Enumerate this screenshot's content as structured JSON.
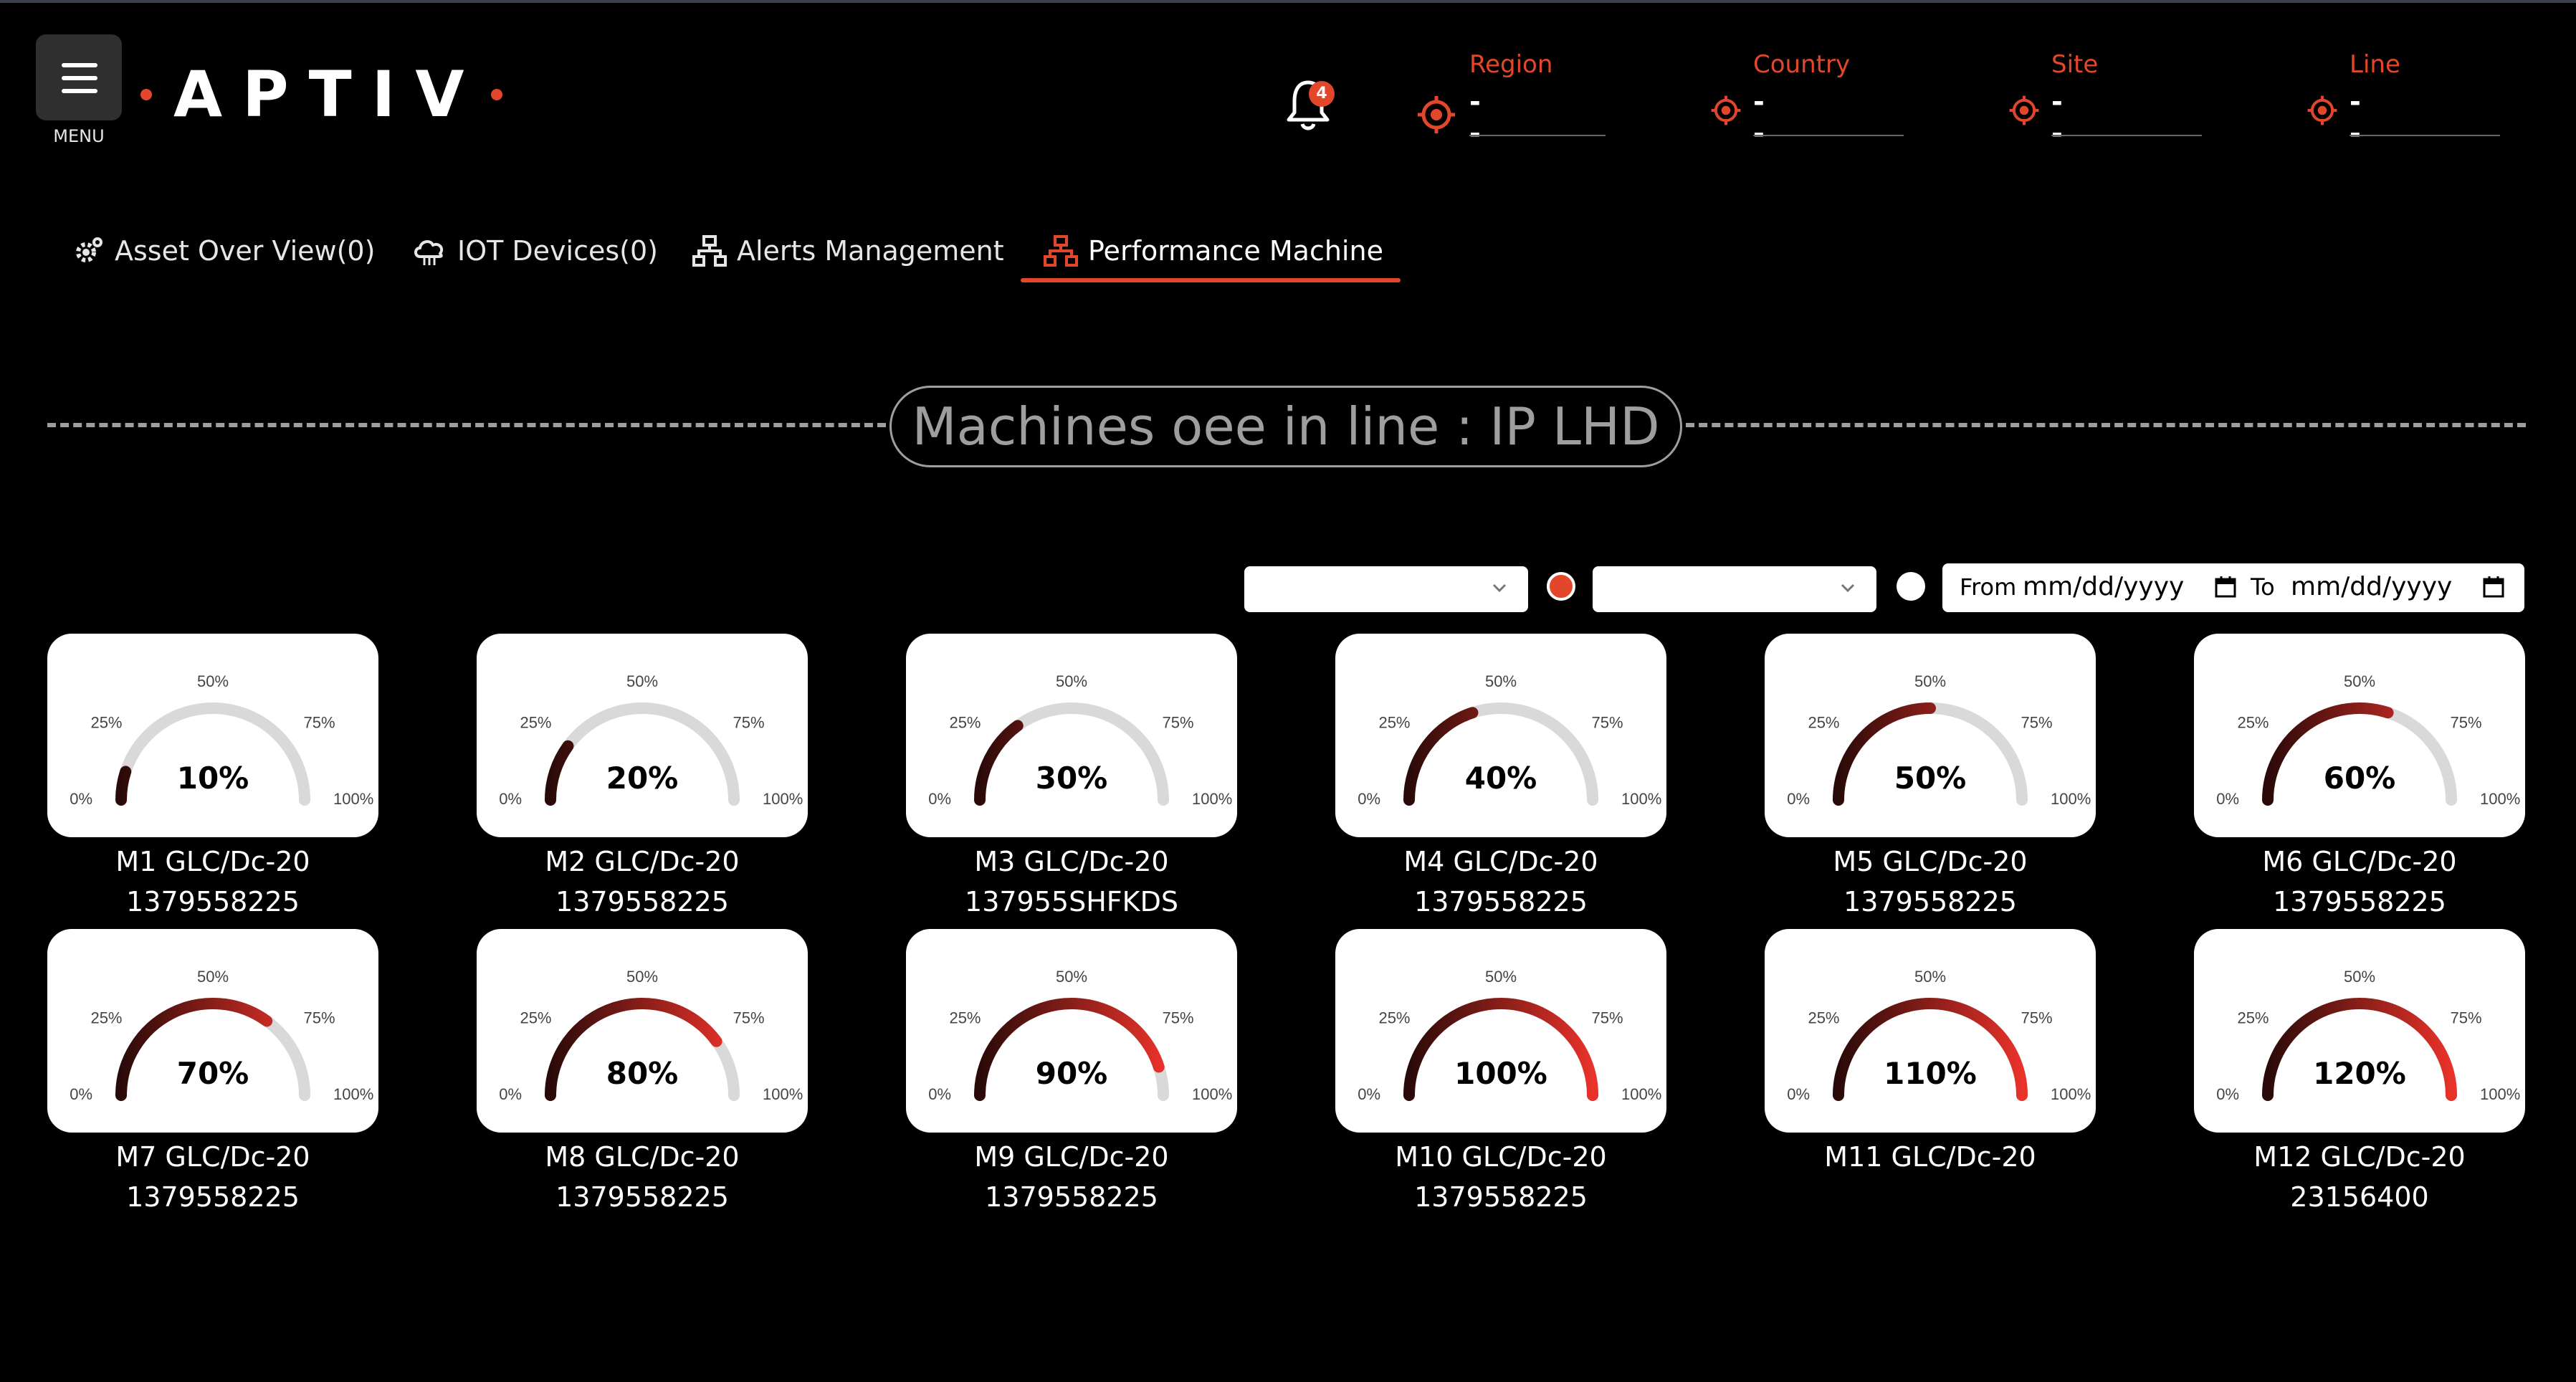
{
  "header": {
    "menu_label": "MENU",
    "brand": "APTIV",
    "notifications_count": "4",
    "filters": [
      {
        "label": "Region",
        "value": "--"
      },
      {
        "label": "Country",
        "value": "--"
      },
      {
        "label": "Site",
        "value": "--"
      },
      {
        "label": "Line",
        "value": "--"
      }
    ]
  },
  "tabs": [
    {
      "label": "Asset Over View(0)",
      "icon": "gear-icon",
      "active": false
    },
    {
      "label": "IOT Devices(0)",
      "icon": "cloud-icon",
      "active": false
    },
    {
      "label": "Alerts Management",
      "icon": "network-icon",
      "active": false
    },
    {
      "label": "Performance Machine",
      "icon": "network-icon",
      "active": true
    }
  ],
  "section_title": "Machines oee in line : IP LHD",
  "date_range": {
    "from_label": "From",
    "from_placeholder": "mm/dd/yyyy",
    "to_label": "To",
    "to_placeholder": "mm/dd/yyyy"
  },
  "gauge_ticks": [
    "0%",
    "25%",
    "50%",
    "75%",
    "100%"
  ],
  "colors": {
    "accent": "#e2472b",
    "gauge_track": "#d9d9d9",
    "gauge_dark": "#2a0a08",
    "gauge_red": "#e8322a"
  },
  "machines": [
    {
      "value": 10,
      "display": "10%",
      "name": "M1 GLC/Dc-20",
      "code": "1379558225"
    },
    {
      "value": 20,
      "display": "20%",
      "name": "M2 GLC/Dc-20",
      "code": "1379558225"
    },
    {
      "value": 30,
      "display": "30%",
      "name": "M3 GLC/Dc-20",
      "code": "137955SHFKDS"
    },
    {
      "value": 40,
      "display": "40%",
      "name": "M4 GLC/Dc-20",
      "code": "1379558225"
    },
    {
      "value": 50,
      "display": "50%",
      "name": "M5 GLC/Dc-20",
      "code": "1379558225"
    },
    {
      "value": 60,
      "display": "60%",
      "name": "M6 GLC/Dc-20",
      "code": "1379558225"
    },
    {
      "value": 70,
      "display": "70%",
      "name": "M7 GLC/Dc-20",
      "code": "1379558225"
    },
    {
      "value": 80,
      "display": "80%",
      "name": "M8 GLC/Dc-20",
      "code": "1379558225"
    },
    {
      "value": 90,
      "display": "90%",
      "name": "M9 GLC/Dc-20",
      "code": "1379558225"
    },
    {
      "value": 100,
      "display": "100%",
      "name": "M10 GLC/Dc-20",
      "code": "1379558225"
    },
    {
      "value": 110,
      "display": "110%",
      "name": "M11 GLC/Dc-20",
      "code": ""
    },
    {
      "value": 120,
      "display": "120%",
      "name": "M12 GLC/Dc-20",
      "code": "23156400"
    }
  ]
}
